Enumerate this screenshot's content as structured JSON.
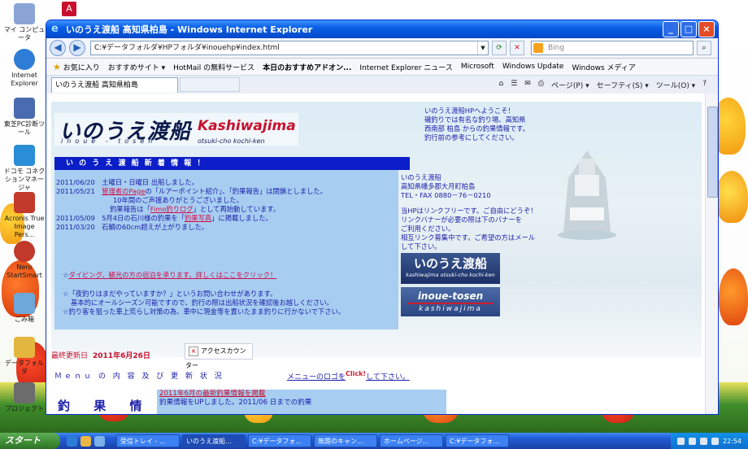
{
  "desktop": {
    "icons": [
      {
        "label": "マイ コンピュータ",
        "color": "#8aa4d6"
      },
      {
        "label": "Internet Explorer",
        "color": "#2d7dd6"
      },
      {
        "label": "東芝PC診断ツール",
        "color": "#4a6bb0"
      },
      {
        "label": "ドコモ コネクションマネージャ",
        "color": "#2a8dd8"
      },
      {
        "label": "Acronis True Image Pers...",
        "color": "#c23a2b"
      },
      {
        "label": "Nero StartSmart",
        "color": "#c0392b"
      },
      {
        "label": "ごみ箱",
        "color": "#6da8d8"
      },
      {
        "label": "データフォルダ",
        "color": "#e3b640"
      },
      {
        "label": "プロジェクト",
        "color": "#6c6c6c"
      }
    ],
    "top_icon_color": "#c8102e"
  },
  "browser": {
    "title": "いのうえ渡船 高知県柏島 - Windows Internet Explorer",
    "address": "C:¥データフォルダ¥HPフォルダ¥inouehp¥index.html",
    "search_placeholder": "Bing",
    "favorites_label": "お気に入り",
    "favbar_items": [
      "おすすめサイト ▾",
      "HotMail の無料サービス",
      "本日のおすすめアドオン...",
      "Internet Explorer ニュース",
      "Microsoft",
      "Windows Update",
      "Windows メディア"
    ],
    "tab_label": "いのうえ渡船 高知県柏島",
    "tools": [
      "ページ(P) ▾",
      "セーフティ(S) ▾",
      "ツール(O) ▾"
    ],
    "buttons": {
      "minimize": "_",
      "maximize": "□",
      "close": "×"
    }
  },
  "page": {
    "logo": {
      "jp": "いのうえ渡船",
      "en": "Kashiwajima",
      "sub": "inoue - tosen",
      "sub2": "otsuki-cho kochi-ken"
    },
    "intro": [
      "いのうえ渡船HPへようこそ！",
      "磯釣りでは有名な釣り場、高知県",
      "西南部 柏島 からの釣果情報です。",
      "釣行前の参考にしてください。"
    ],
    "news_title": "い の う え 渡 船 新 着 情 報 ！",
    "news": [
      {
        "date": "2011/06/20",
        "text": "土曜日・日曜日 出船しました。"
      },
      {
        "date": "2011/05/21",
        "link": "管理者のPage",
        "text": "の「ルアーポイント紹介」、「釣果報告」は閉鎖としました。"
      },
      {
        "date": "",
        "text": "10年間のご声援ありがとうございました。"
      },
      {
        "date": "",
        "text": "釣果報告は「",
        "link": "Fimo釣りログ",
        "text2": "」として再始動しています。"
      },
      {
        "date": "2011/05/09",
        "text": "5月4日の石川様の釣果を「",
        "link": "釣果写真",
        "text2": "」に掲載しました。"
      },
      {
        "date": "2011/03/20",
        "text": "石鯛の60cm超えが上がりました。"
      }
    ],
    "address": [
      "いのうえ渡船",
      "高知県幡多郡大月町柏島",
      "TEL・FAX 0880－76－0210",
      "",
      "当HPはリンクフリーです。ご自由にどうぞ！",
      "リンクバナーが必要の際は下のバナーを",
      "ご利用ください。",
      "相互リンク募集中です。ご希望の方はメール",
      "して下さい。"
    ],
    "banner1": {
      "title": "いのうえ渡船",
      "sub": "kashiwajima otsuki-cho kochi-ken"
    },
    "banner2": {
      "title": "inoue-tosen",
      "sub": "kashiwajima"
    },
    "info": {
      "line1_prefix": "☆",
      "line1_link": "ダイビング、観光の方の宿泊を承ります。詳しくはここをクリック！",
      "line2": "☆「夜釣りはまだやっていますか？」というお問い合わせがあります。",
      "line3": "基本的にオールシーズン可能ですので、釣行の際は出船状況を確認後お越しください。",
      "line4": "☆釣り客を狙った車上荒らし対策の為、車中に現金等を置いたまま釣りに行かないで下さい。"
    },
    "updated_label": "最終更新日",
    "updated_date": "2011年6月26日",
    "counter_label": "アクセスカウンター",
    "menu_head": "Ｍｅｎｕ の 内 容 及 び 更 新 状 況",
    "menu_link": "メニューのロゴを",
    "click": "Click!",
    "menu_link2": "して下さい。",
    "june_link": "2011年6月の最新釣果情報を掲載",
    "june_line2": "釣果情報をUPしました。2011/06 日までの釣果",
    "big_menu": "釣 果 情 報"
  },
  "taskbar": {
    "start": "スタート",
    "buttons": [
      "受信トレイ - ...",
      "いのうえ渡船...",
      "C:¥データフォ...",
      "無題のキャン...",
      "ホームページ...",
      "C:¥データフォ..."
    ],
    "clock": "22:54"
  }
}
